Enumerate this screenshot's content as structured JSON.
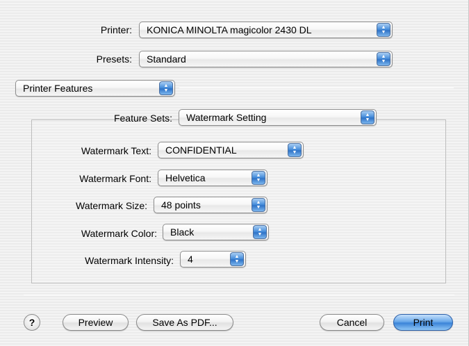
{
  "printer": {
    "label": "Printer:",
    "value": "KONICA MINOLTA magicolor 2430 DL"
  },
  "presets": {
    "label": "Presets:",
    "value": "Standard"
  },
  "panel_selector": {
    "value": "Printer Features"
  },
  "feature_sets": {
    "label": "Feature Sets:",
    "value": "Watermark Setting"
  },
  "watermark": {
    "text": {
      "label": "Watermark Text:",
      "value": "CONFIDENTIAL"
    },
    "font": {
      "label": "Watermark Font:",
      "value": "Helvetica"
    },
    "size": {
      "label": "Watermark Size:",
      "value": "48 points"
    },
    "color": {
      "label": "Watermark Color:",
      "value": "Black"
    },
    "intensity": {
      "label": "Watermark Intensity:",
      "value": "4"
    }
  },
  "buttons": {
    "help": "?",
    "preview": "Preview",
    "save_pdf": "Save As PDF...",
    "cancel": "Cancel",
    "print": "Print"
  },
  "icons": {
    "popup_arrows": "updown-arrows-icon",
    "help": "question-mark-icon"
  },
  "colors": {
    "accent_blue": "#3b84d8"
  }
}
